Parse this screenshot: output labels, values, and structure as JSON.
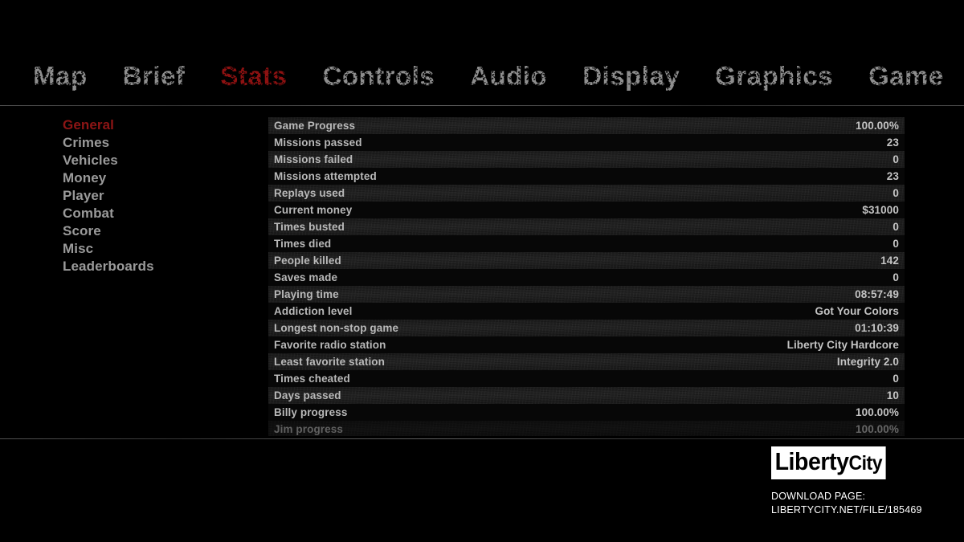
{
  "colors": {
    "background": "#000000",
    "accent_red": "#8d1111",
    "nav_inactive": "#8e8e8e",
    "sidebar_inactive": "#9a9a9a",
    "row_band": "#1c1c1c",
    "row_dark": "#070707",
    "text": "#b9b9b9",
    "watermark": "#ffffff"
  },
  "nav": {
    "items": [
      {
        "label": "Map",
        "active": false
      },
      {
        "label": "Brief",
        "active": false
      },
      {
        "label": "Stats",
        "active": true
      },
      {
        "label": "Controls",
        "active": false
      },
      {
        "label": "Audio",
        "active": false
      },
      {
        "label": "Display",
        "active": false
      },
      {
        "label": "Graphics",
        "active": false
      },
      {
        "label": "Game",
        "active": false
      }
    ]
  },
  "sidebar": {
    "items": [
      {
        "label": "General",
        "active": true
      },
      {
        "label": "Crimes",
        "active": false
      },
      {
        "label": "Vehicles",
        "active": false
      },
      {
        "label": "Money",
        "active": false
      },
      {
        "label": "Player",
        "active": false
      },
      {
        "label": "Combat",
        "active": false
      },
      {
        "label": "Score",
        "active": false
      },
      {
        "label": "Misc",
        "active": false
      },
      {
        "label": "Leaderboards",
        "active": false
      }
    ]
  },
  "stats": {
    "rows": [
      {
        "label": "Game Progress",
        "value": "100.00%",
        "band": true,
        "faded": false
      },
      {
        "label": "Missions passed",
        "value": "23",
        "band": false,
        "faded": false
      },
      {
        "label": "Missions failed",
        "value": "0",
        "band": true,
        "faded": false
      },
      {
        "label": "Missions attempted",
        "value": "23",
        "band": false,
        "faded": false
      },
      {
        "label": "Replays used",
        "value": "0",
        "band": true,
        "faded": false
      },
      {
        "label": "Current money",
        "value": "$31000",
        "band": false,
        "faded": false
      },
      {
        "label": "Times busted",
        "value": "0",
        "band": true,
        "faded": false
      },
      {
        "label": "Times died",
        "value": "0",
        "band": false,
        "faded": false
      },
      {
        "label": "People killed",
        "value": "142",
        "band": true,
        "faded": false
      },
      {
        "label": "Saves made",
        "value": "0",
        "band": false,
        "faded": false
      },
      {
        "label": "Playing time",
        "value": "08:57:49",
        "band": true,
        "faded": false
      },
      {
        "label": "Addiction level",
        "value": "Got Your Colors",
        "band": false,
        "faded": false
      },
      {
        "label": "Longest non-stop game",
        "value": "01:10:39",
        "band": true,
        "faded": false
      },
      {
        "label": "Favorite radio station",
        "value": "Liberty City Hardcore",
        "band": false,
        "faded": false
      },
      {
        "label": "Least favorite station",
        "value": "Integrity 2.0",
        "band": true,
        "faded": false
      },
      {
        "label": "Times cheated",
        "value": "0",
        "band": false,
        "faded": false
      },
      {
        "label": "Days passed",
        "value": "10",
        "band": true,
        "faded": false
      },
      {
        "label": "Billy progress",
        "value": "100.00%",
        "band": false,
        "faded": false
      },
      {
        "label": "Jim progress",
        "value": "100.00%",
        "band": true,
        "faded": true
      }
    ]
  },
  "watermark": {
    "logo_primary": "Liberty",
    "logo_secondary": "City",
    "download_label": "DOWNLOAD PAGE:",
    "download_url": "LIBERTYCITY.NET/FILE/185469"
  }
}
